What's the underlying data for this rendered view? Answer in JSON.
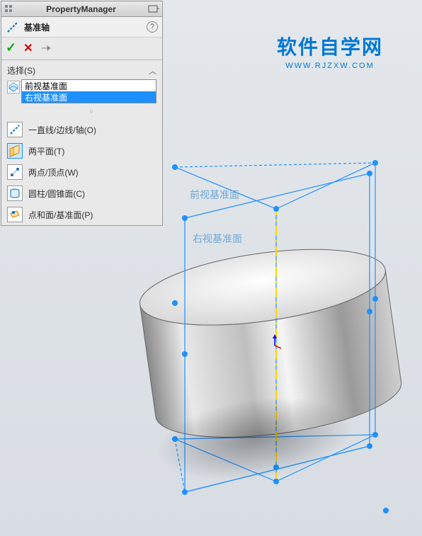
{
  "panel": {
    "title": "PropertyManager",
    "feature_name": "基准轴",
    "help_tip": "?",
    "actions": {
      "ok": "✓",
      "cancel": "✕",
      "pin": "⊣"
    }
  },
  "selection": {
    "header": "选择(S)",
    "items": [
      "前视基准面",
      "右视基准面"
    ],
    "selected_index": 1
  },
  "options": [
    {
      "label": "一直线/边线/轴(O)",
      "icon": "line-edge-axis-icon"
    },
    {
      "label": "两平面(T)",
      "icon": "two-planes-icon",
      "active": true
    },
    {
      "label": "两点/顶点(W)",
      "icon": "two-points-icon"
    },
    {
      "label": "圆柱/圆锥面(C)",
      "icon": "cylinder-cone-icon"
    },
    {
      "label": "点和面/基准面(P)",
      "icon": "point-face-icon"
    }
  ],
  "viewport": {
    "plane_labels": [
      "前视基准面",
      "右视基准面"
    ]
  },
  "watermark": {
    "cn": "软件自学网",
    "en": "WWW.RJZXW.COM"
  }
}
